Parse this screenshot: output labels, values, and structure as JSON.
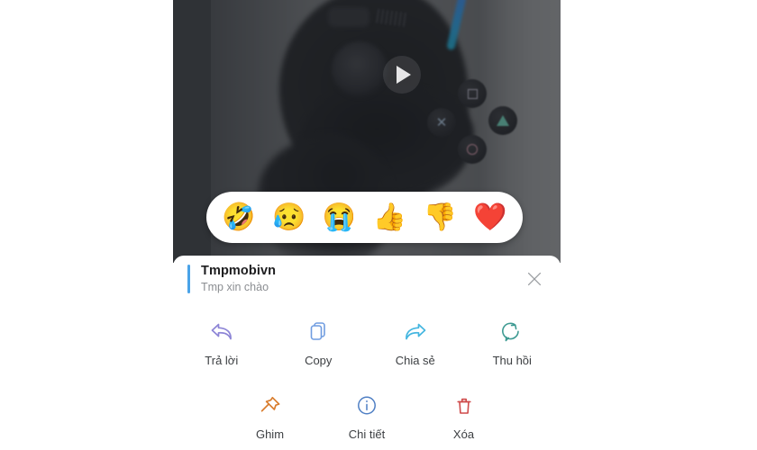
{
  "media": {
    "type": "video-thumbnail",
    "play_icon": "play-triangle-icon",
    "subject": "black game controller"
  },
  "reaction_bar": {
    "reactions": [
      {
        "name": "rolling-on-floor-laughing-emoji",
        "glyph": "🤣"
      },
      {
        "name": "sweat-surprised-face-emoji",
        "glyph": "😥"
      },
      {
        "name": "loudly-crying-face-emoji",
        "glyph": "😭"
      },
      {
        "name": "thumbs-up-emoji",
        "glyph": "👍"
      },
      {
        "name": "thumbs-down-emoji",
        "glyph": "👎"
      },
      {
        "name": "red-heart-emoji",
        "glyph": "❤️"
      }
    ]
  },
  "preview": {
    "title": "Tmpmobivn",
    "subtitle": "Tmp xin chào",
    "close_label": "×",
    "accent_color": "#4aa3e8"
  },
  "actions": {
    "row1": [
      {
        "label": "Trả lời",
        "icon": "reply-arrow-icon",
        "color": "#8d85d6"
      },
      {
        "label": "Copy",
        "icon": "copy-pages-icon",
        "color": "#6f9ce0"
      },
      {
        "label": "Chia sẻ",
        "icon": "share-arrow-icon",
        "color": "#44b6e0"
      },
      {
        "label": "Thu hồi",
        "icon": "recall-refresh-icon",
        "color": "#3f9b93"
      }
    ],
    "row2": [
      {
        "label": "Ghim",
        "icon": "pin-icon",
        "color": "#d97d2e"
      },
      {
        "label": "Chi tiết",
        "icon": "info-circle-icon",
        "color": "#4f7fc4"
      },
      {
        "label": "Xóa",
        "icon": "trash-delete-icon",
        "color": "#cf4a4a"
      }
    ]
  },
  "colors": {
    "sheet_background": "#ffffff",
    "overlay": "#55595f",
    "label_text": "#3c3f42",
    "subtitle_text": "#8b8e92"
  }
}
